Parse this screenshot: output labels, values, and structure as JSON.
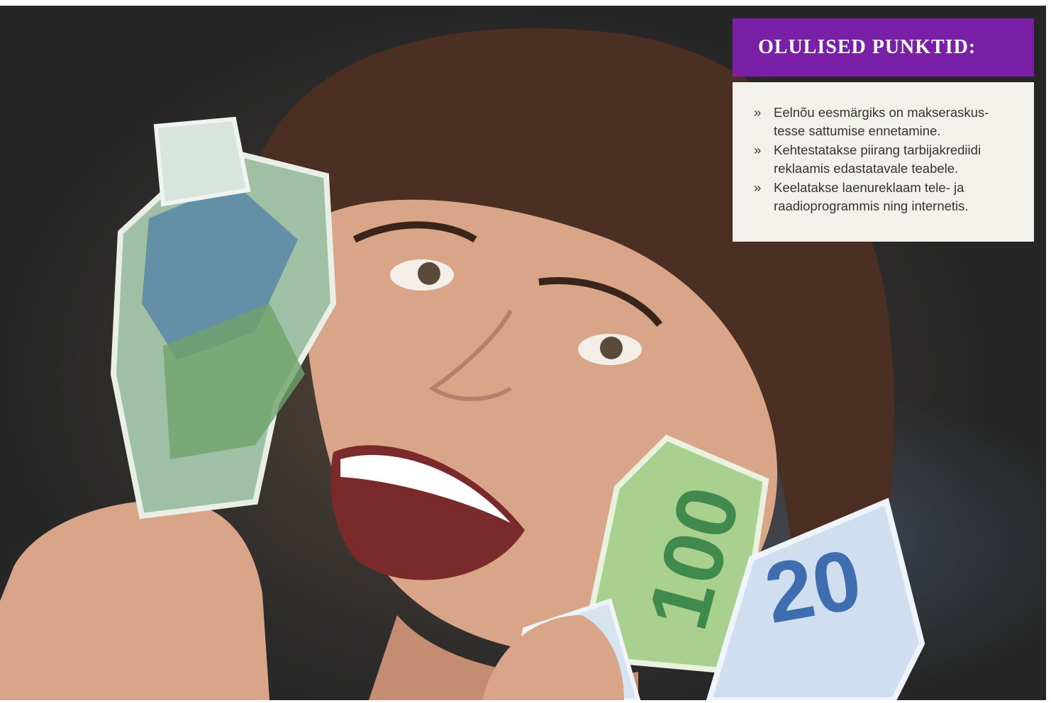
{
  "key_points": {
    "title": "OLULISED PUNKTID:",
    "bullet_symbol": "»",
    "items": [
      "Eelnõu eesmärgiks on makseraskus-tesse sattumise ennetamine.",
      "Kehtestatakse piirang tarbijakrediidi reklaamis edastatavale teabele.",
      "Keelatakse laenureklaam tele- ja raadioprogrammis ning internetis."
    ]
  },
  "photo": {
    "banknote_labels": [
      "100",
      "20"
    ]
  },
  "colors": {
    "header_purple": "#7a20a6",
    "panel_background": "#f2f1ec",
    "text": "#333333"
  }
}
